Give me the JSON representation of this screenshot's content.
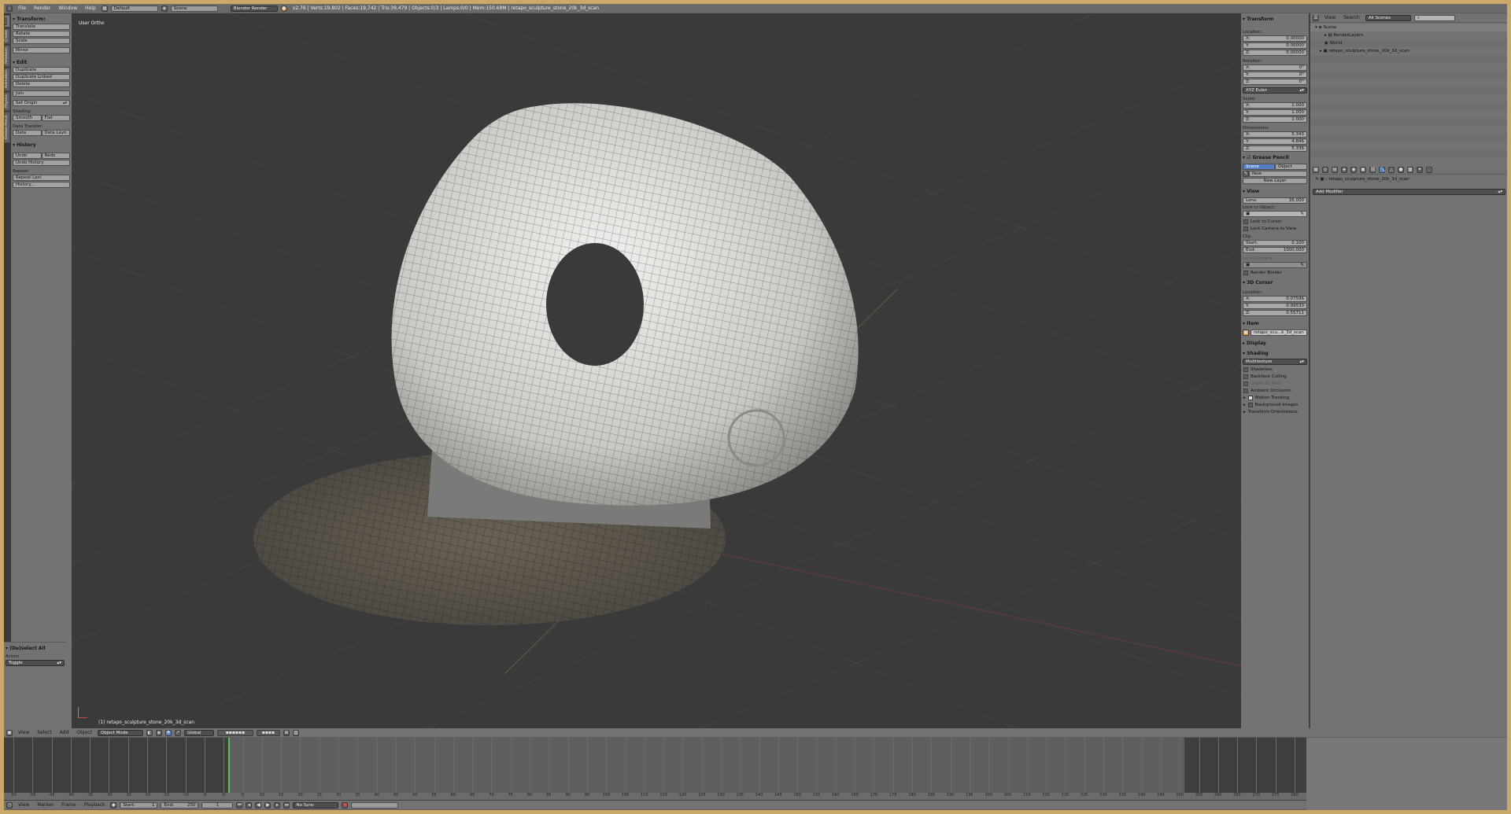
{
  "top_bar": {
    "menus": [
      "File",
      "Render",
      "Window",
      "Help"
    ],
    "layout": "Default",
    "scene": "Scene",
    "engine": "Blender Render",
    "stats": "v2.76 | Verts:19,802 | Faces:19,742 | Tris:39,479 | Objects:0/3 | Lamps:0/0 | Mem:150.68M | retapo_sculpture_stone_20k_3d_scan"
  },
  "tool_tabs": [
    "Tools",
    "Create",
    "Relations",
    "Animation",
    "Physics",
    "Grease Pencil"
  ],
  "toolshelf": {
    "transform_title": "Transform:",
    "transform_buttons": [
      "Translate",
      "Rotate",
      "Scale",
      "Mirror"
    ],
    "edit_title": "Edit",
    "edit_buttons": [
      "Duplicate",
      "Duplicate Linked",
      "Delete",
      "Join"
    ],
    "set_origin": "Set Origin",
    "shading_label": "Shading:",
    "shading_buttons": [
      "Smooth",
      "Flat"
    ],
    "data_transfer_label": "Data Transfer:",
    "data_buttons": [
      "Data",
      "Data Layo"
    ],
    "history_title": "History",
    "history_row": [
      "Undo",
      "Redo"
    ],
    "undo_history": "Undo History",
    "repeat_label": "Repeat:",
    "repeat_last": "Repeat Last",
    "history_btn": "History..."
  },
  "operator_panel": {
    "title": "(De)select All",
    "action_label": "Action",
    "action_value": "Toggle"
  },
  "viewport": {
    "view_label": "User Ortho",
    "object_label": "(1) retapo_sculpture_stone_20k_3d_scan"
  },
  "viewport_header": {
    "menus": [
      "View",
      "Select",
      "Add",
      "Object"
    ],
    "mode": "Object Mode",
    "orientation": "Global"
  },
  "properties_panel": {
    "transform_title": "Transform",
    "location_label": "Location:",
    "location": [
      [
        "X:",
        "0.00000"
      ],
      [
        "Y:",
        "0.00000"
      ],
      [
        "Z:",
        "0.00000"
      ]
    ],
    "rotation_label": "Rotation:",
    "rotation": [
      [
        "X:",
        "0°"
      ],
      [
        "Y:",
        "0°"
      ],
      [
        "Z:",
        "0°"
      ]
    ],
    "rotation_mode": "XYZ Euler",
    "scale_label": "Scale:",
    "scale": [
      [
        "X:",
        "1.000"
      ],
      [
        "Y:",
        "1.000"
      ],
      [
        "Z:",
        "1.000"
      ]
    ],
    "dimensions_label": "Dimensions:",
    "dimensions": [
      [
        "X:",
        "5.343"
      ],
      [
        "Y:",
        "4.846"
      ],
      [
        "Z:",
        "5.336"
      ]
    ],
    "grease_pencil_title": "Grease Pencil",
    "gp_tabs": [
      "Scene",
      "Object"
    ],
    "gp_new": "New",
    "gp_new_layer": "New Layer",
    "view_title": "View",
    "lens_label": "Lens:",
    "lens_value": "35.000",
    "lock_to_object": "Lock to Object:",
    "lock_to_cursor": "Lock to Cursor",
    "lock_camera": "Lock Camera to View",
    "clip_label": "Clip:",
    "clip_start": [
      "Start:",
      "0.100"
    ],
    "clip_end": [
      "End:",
      "1000.000"
    ],
    "local_camera": "Local Camera:",
    "render_border": "Render Border",
    "cursor_title": "3D Cursor",
    "cursor_location_label": "Location:",
    "cursor": [
      [
        "X:",
        "0.07596"
      ],
      [
        "Y:",
        "0.99530"
      ],
      [
        "Z:",
        "0.55711"
      ]
    ],
    "item_title": "Item",
    "item_name": "retapo_scu...k_3d_scan",
    "display_title": "Display",
    "shading_title": "Shading",
    "shading_mode": "Multitexture",
    "shading_opts": [
      "Shadeless",
      "Backface Culling",
      "Depth Of Field",
      "Ambient Occlusion"
    ],
    "motion_tracking": "Motion Tracking",
    "background_images": "Background Images",
    "transform_orientations": "Transform Orientations"
  },
  "outliner": {
    "menus": [
      "View",
      "Search"
    ],
    "filter": "All Scenes",
    "tree": [
      "Scene",
      "RenderLayers",
      "World",
      "retapo_sculpture_stone_20k_3d_scan"
    ]
  },
  "modifiers": {
    "object_name": "retapo_sculpture_stone_20k_3d_scan",
    "add_modifier": "Add Modifier"
  },
  "timeline": {
    "ticks": [
      "-55",
      "-50",
      "-45",
      "-40",
      "-35",
      "-30",
      "-25",
      "-20",
      "-15",
      "-10",
      "-5",
      "0",
      "5",
      "10",
      "15",
      "20",
      "25",
      "30",
      "35",
      "40",
      "45",
      "50",
      "55",
      "60",
      "65",
      "70",
      "75",
      "80",
      "85",
      "90",
      "95",
      "100",
      "105",
      "110",
      "115",
      "120",
      "125",
      "130",
      "135",
      "140",
      "145",
      "150",
      "155",
      "160",
      "165",
      "170",
      "175",
      "180",
      "185",
      "190",
      "195",
      "200",
      "205",
      "210",
      "215",
      "220",
      "225",
      "230",
      "235",
      "240",
      "245",
      "250",
      "255",
      "260",
      "265",
      "270",
      "275",
      "280"
    ],
    "menus": [
      "View",
      "Marker",
      "Frame",
      "Playback"
    ],
    "start_label": "Start:",
    "start": "1",
    "end_label": "End:",
    "end": "250",
    "current": "1",
    "sync": "No Sync"
  },
  "colors": {
    "background": "#393939",
    "panel": "#737373",
    "header": "#727272",
    "accent": "#5680c2",
    "mesh": "#dcdcdc"
  }
}
